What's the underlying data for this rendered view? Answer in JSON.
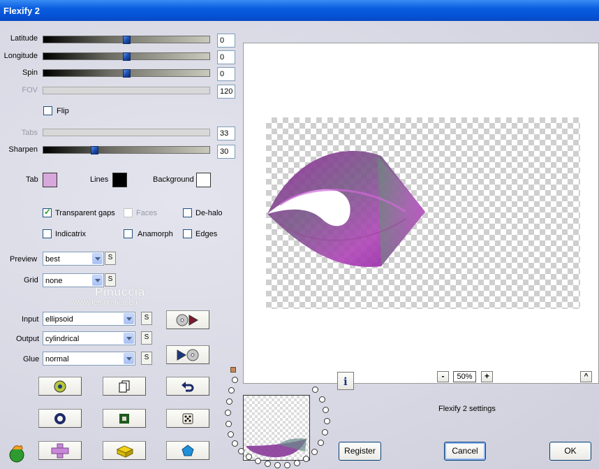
{
  "window": {
    "title": "Flexify 2"
  },
  "sliders": [
    {
      "label": "Latitude",
      "value": "0",
      "level": 0.5,
      "enabled": true
    },
    {
      "label": "Longitude",
      "value": "0",
      "level": 0.5,
      "enabled": true
    },
    {
      "label": "Spin",
      "value": "0",
      "level": 0.5,
      "enabled": true
    },
    {
      "label": "FOV",
      "value": "120",
      "enabled": false
    },
    {
      "label": "Tabs",
      "value": "33",
      "enabled": false
    },
    {
      "label": "Sharpen",
      "value": "30",
      "level": 0.3,
      "enabled": true
    }
  ],
  "flip": {
    "label": "Flip",
    "checked": false
  },
  "colors": {
    "tab": {
      "label": "Tab",
      "color": "#d8a8dc"
    },
    "lines": {
      "label": "Lines",
      "color": "#000000"
    },
    "background": {
      "label": "Background",
      "color": "#ffffff"
    }
  },
  "options": {
    "transparent_gaps": {
      "label": "Transparent gaps",
      "checked": true
    },
    "faces": {
      "label": "Faces",
      "checked": false,
      "enabled": false
    },
    "de_halo": {
      "label": "De-halo",
      "checked": false
    },
    "indicatrix": {
      "label": "Indicatrix",
      "checked": false
    },
    "anamorph": {
      "label": "Anamorph",
      "checked": false
    },
    "edges": {
      "label": "Edges",
      "checked": false
    }
  },
  "preview": {
    "label": "Preview",
    "value": "best"
  },
  "grid": {
    "label": "Grid",
    "value": "none"
  },
  "input": {
    "label": "Input",
    "value": "ellipsoid"
  },
  "output": {
    "label": "Output",
    "value": "cylindrical"
  },
  "glue": {
    "label": "Glue",
    "value": "normal"
  },
  "s_label": "S",
  "watermark": {
    "name": "Pinuccia",
    "site": "www.letsgrafica.eu"
  },
  "zoom": {
    "minus": "-",
    "value": "50%",
    "plus": "+"
  },
  "up_label": "^",
  "info_label": "i",
  "status_text": "Flexify 2 settings",
  "buttons": {
    "register": "Register",
    "cancel": "Cancel",
    "ok": "OK"
  }
}
